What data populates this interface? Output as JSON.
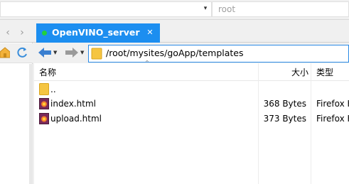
{
  "top_bar": {
    "path_placeholder": "root"
  },
  "tabs": [
    {
      "label": "OpenVINO_server",
      "status_color": "#22d13b",
      "active": true
    }
  ],
  "address_bar": {
    "path": "/root/mysites/goApp/templates"
  },
  "file_list": {
    "columns": {
      "name": "名称",
      "size": "大小",
      "type": "类型"
    },
    "rows": [
      {
        "name": "..",
        "size": "",
        "type": "",
        "icon": "folder-icon"
      },
      {
        "name": "index.html",
        "size": "368 Bytes",
        "type": "Firefox H",
        "icon": "firefox-html-icon"
      },
      {
        "name": "upload.html",
        "size": "373 Bytes",
        "type": "Firefox H",
        "icon": "firefox-html-icon"
      }
    ]
  },
  "colors": {
    "tab_active": "#1c8ef0",
    "address_border": "#2a8ae6",
    "folder": "#f5c542"
  }
}
